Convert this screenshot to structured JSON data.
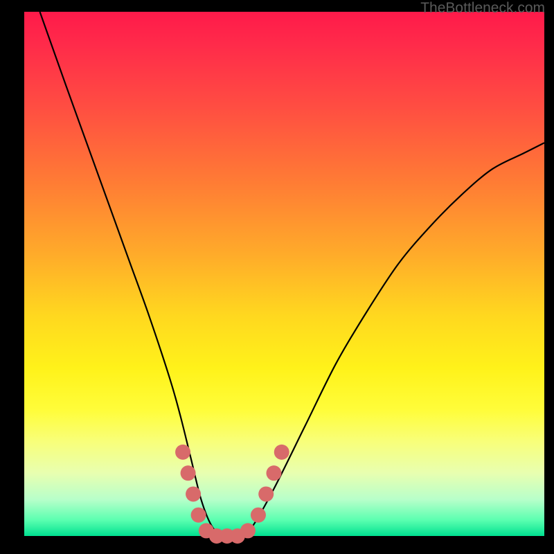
{
  "watermark": "TheBottleneck.com",
  "chart_data": {
    "type": "line",
    "title": "",
    "xlabel": "",
    "ylabel": "",
    "xlim": [
      0,
      100
    ],
    "ylim": [
      0,
      100
    ],
    "series": [
      {
        "name": "bottleneck-curve",
        "x": [
          3,
          8,
          12,
          16,
          20,
          24,
          28,
          30,
          32,
          34,
          36,
          38,
          40,
          42,
          44,
          48,
          54,
          60,
          66,
          72,
          78,
          84,
          90,
          96,
          100
        ],
        "y": [
          100,
          86,
          75,
          64,
          53,
          42,
          30,
          23,
          15,
          7,
          2,
          0,
          0,
          0,
          2,
          9,
          21,
          33,
          43,
          52,
          59,
          65,
          70,
          73,
          75
        ]
      }
    ],
    "markers": {
      "name": "highlight-dots",
      "color": "#d86a6a",
      "points": [
        {
          "x": 30.5,
          "y": 16
        },
        {
          "x": 31.5,
          "y": 12
        },
        {
          "x": 32.5,
          "y": 8
        },
        {
          "x": 33.5,
          "y": 4
        },
        {
          "x": 35,
          "y": 1
        },
        {
          "x": 37,
          "y": 0
        },
        {
          "x": 39,
          "y": 0
        },
        {
          "x": 41,
          "y": 0
        },
        {
          "x": 43,
          "y": 1
        },
        {
          "x": 45,
          "y": 4
        },
        {
          "x": 46.5,
          "y": 8
        },
        {
          "x": 48,
          "y": 12
        },
        {
          "x": 49.5,
          "y": 16
        }
      ]
    }
  }
}
